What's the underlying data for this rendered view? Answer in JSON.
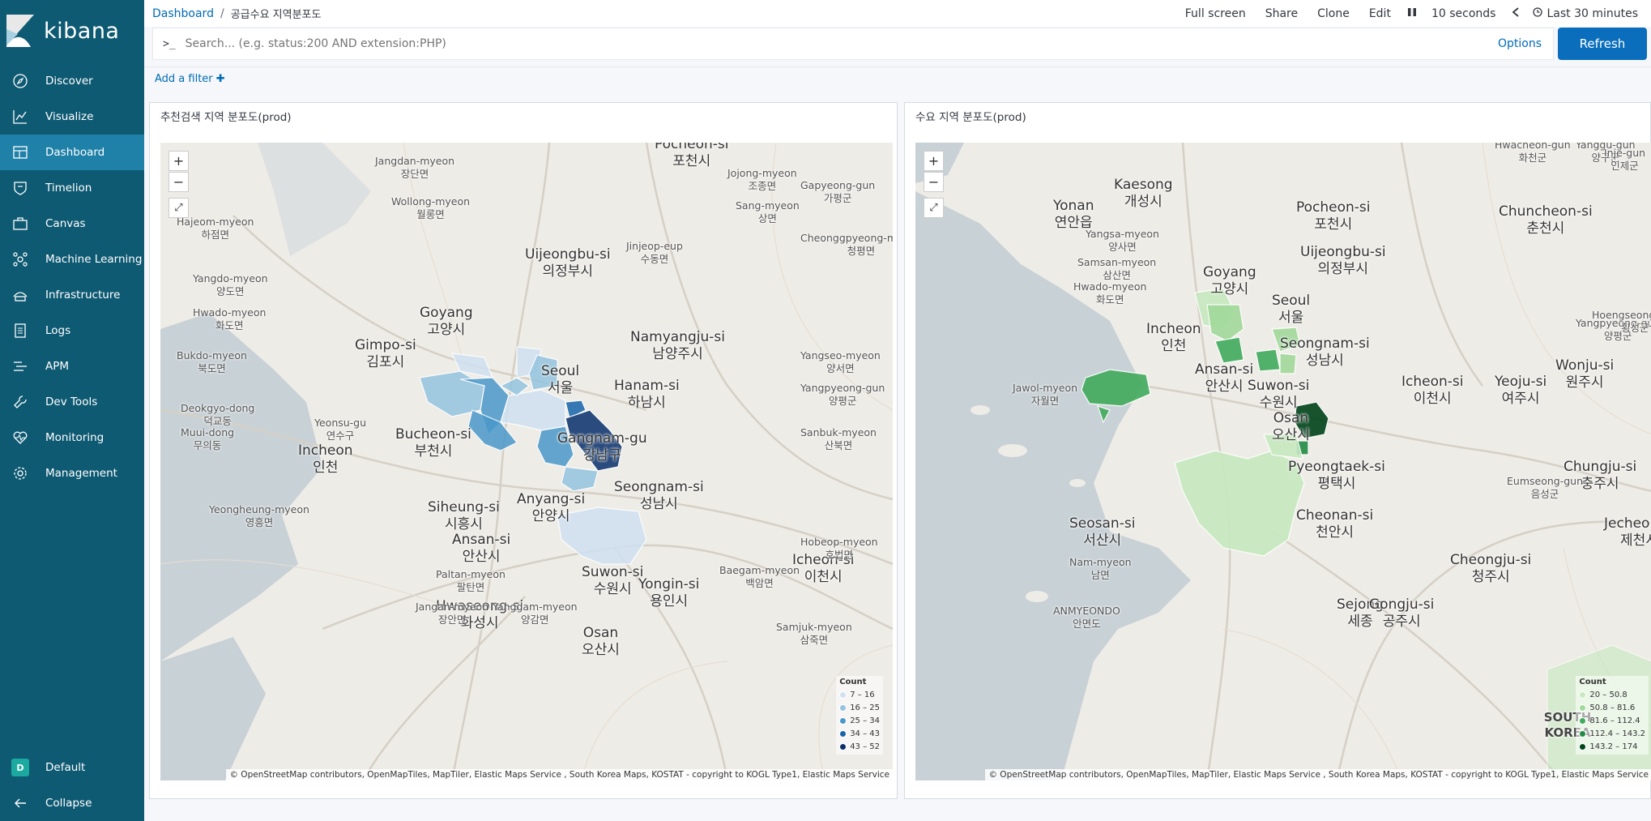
{
  "app": {
    "logo_text": "kibana"
  },
  "sidebar": {
    "items": [
      {
        "label": "Discover",
        "icon": "compass-icon"
      },
      {
        "label": "Visualize",
        "icon": "chart-icon"
      },
      {
        "label": "Dashboard",
        "icon": "dashboard-icon"
      },
      {
        "label": "Timelion",
        "icon": "shield-icon"
      },
      {
        "label": "Canvas",
        "icon": "briefcase-icon"
      },
      {
        "label": "Machine Learning",
        "icon": "ml-icon"
      },
      {
        "label": "Infrastructure",
        "icon": "infrastructure-icon"
      },
      {
        "label": "Logs",
        "icon": "logs-icon"
      },
      {
        "label": "APM",
        "icon": "apm-icon"
      },
      {
        "label": "Dev Tools",
        "icon": "wrench-icon"
      },
      {
        "label": "Monitoring",
        "icon": "heartbeat-icon"
      },
      {
        "label": "Management",
        "icon": "gear-icon"
      }
    ],
    "space": {
      "label": "Default",
      "avatar": "D"
    },
    "collapse_label": "Collapse"
  },
  "breadcrumb": {
    "root": "Dashboard",
    "separator": "/",
    "current": "공급수요 지역분포도"
  },
  "top_actions": {
    "full_screen": "Full screen",
    "share": "Share",
    "clone": "Clone",
    "edit": "Edit",
    "interval": "10 seconds",
    "time_range": "Last 30 minutes"
  },
  "query": {
    "prompt": ">_",
    "placeholder": "Search... (e.g. status:200 AND extension:PHP)",
    "options_label": "Options",
    "refresh_label": "Refresh"
  },
  "filter": {
    "add_label": "Add a filter"
  },
  "panels": [
    {
      "title": "추천검색 지역 분포도(prod)",
      "legend": {
        "title": "Count",
        "items": [
          {
            "label": "7 – 16",
            "color": "#d0e1f2"
          },
          {
            "label": "16 – 25",
            "color": "#94c4df"
          },
          {
            "label": "25 – 34",
            "color": "#4a98c9"
          },
          {
            "label": "34 – 43",
            "color": "#1764ab"
          },
          {
            "label": "43 – 52",
            "color": "#08306b"
          }
        ]
      },
      "labels": [
        [
          "Pocheon-si",
          "포천시"
        ],
        [
          "Uijeongbu-si",
          "의정부시"
        ],
        [
          "Goyang",
          "고양시"
        ],
        [
          "Namyangju-si",
          "남양주시"
        ],
        [
          "Gimpo-si",
          "김포시"
        ],
        [
          "Seoul",
          "서울"
        ],
        [
          "Hanam-si",
          "하남시"
        ],
        [
          "Bucheon-si",
          "부천시"
        ],
        [
          "Incheon",
          "인천"
        ],
        [
          "Gangnam-gu",
          "강남구"
        ],
        [
          "Seongnam-si",
          "성남시"
        ],
        [
          "Siheung-si",
          "시흥시"
        ],
        [
          "Anyang-si",
          "안양시"
        ],
        [
          "Ansan-si",
          "안산시"
        ],
        [
          "Suwon-si",
          "수원시"
        ],
        [
          "Yongin-si",
          "용인시"
        ],
        [
          "Icheon-si",
          "이천시"
        ],
        [
          "Hwaseong-si",
          "화성시"
        ],
        [
          "Osan",
          "오산시"
        ]
      ],
      "small_labels": [
        [
          "Jangdan-myeon",
          "장단면"
        ],
        [
          "Wollong-myeon",
          "월롱면"
        ],
        [
          "Hajeom-myeon",
          "하점면"
        ],
        [
          "Jojong-myeon",
          "조종면"
        ],
        [
          "Gapyeong-gun",
          "가평군"
        ],
        [
          "Sang-myeon",
          "상면"
        ],
        [
          "Cheonggpyeong-myeon",
          "청평면"
        ],
        [
          "Jinjeop-eup",
          "수동면"
        ],
        [
          "Yangdo-myeon",
          "양도면"
        ],
        [
          "Hwado-myeon",
          "화도면"
        ],
        [
          "Bukdo-myeon",
          "북도면"
        ],
        [
          "Yangseo-myeon",
          "양서면"
        ],
        [
          "Yangpyeong-gun",
          "양평군"
        ],
        [
          "Deokgyo-dong",
          "덕교동"
        ],
        [
          "Muui-dong",
          "무의동"
        ],
        [
          "Yeonsu-gu",
          "연수구"
        ],
        [
          "Sanbuk-myeon",
          "산북면"
        ],
        [
          "Yeongheung-myeon",
          "영흥면"
        ],
        [
          "Hobeop-myeon",
          "호법면"
        ],
        [
          "Paltan-myeon",
          "팔탄면"
        ],
        [
          "Baegam-myeon",
          "백암면"
        ],
        [
          "Jangan-myeon",
          "장안면"
        ],
        [
          "Yanggam-myeon",
          "양감면"
        ],
        [
          "Samjuk-myeon",
          "삼죽면"
        ]
      ],
      "attribution": "© OpenStreetMap contributors, OpenMapTiles, MapTiler, Elastic Maps Service , South Korea Maps, KOSTAT - copyright to KOGL Type1, Elastic Maps Service"
    },
    {
      "title": "수요 지역 분포도(prod)",
      "legend": {
        "title": "Count",
        "items": [
          {
            "label": "20 – 50.8",
            "color": "#c7e9c0"
          },
          {
            "label": "50.8 – 81.6",
            "color": "#a1d99b"
          },
          {
            "label": "81.6 – 112.4",
            "color": "#41ab5d"
          },
          {
            "label": "112.4 – 143.2",
            "color": "#238b45"
          },
          {
            "label": "143.2 – 174",
            "color": "#00441b"
          }
        ]
      },
      "labels": [
        [
          "Kaesong",
          "개성시"
        ],
        [
          "Pocheon-si",
          "포천시"
        ],
        [
          "Chuncheon-si",
          "춘천시"
        ],
        [
          "Yonan",
          "연안읍"
        ],
        [
          "Uijeongbu-si",
          "의정부시"
        ],
        [
          "Goyang",
          "고양시"
        ],
        [
          "Seoul",
          "서울"
        ],
        [
          "Incheon",
          "인천"
        ],
        [
          "Seongnam-si",
          "성남시"
        ],
        [
          "Ansan-si",
          "안산시"
        ],
        [
          "Suwon-si",
          "수원시"
        ],
        [
          "Icheon-si",
          "이천시"
        ],
        [
          "Yeoju-si",
          "여주시"
        ],
        [
          "Wonju-si",
          "원주시"
        ],
        [
          "Osan",
          "오산시"
        ],
        [
          "Pyeongtaek-si",
          "평택시"
        ],
        [
          "Chungju-si",
          "충주시"
        ],
        [
          "Seosan-si",
          "서산시"
        ],
        [
          "Cheonan-si",
          "천안시"
        ],
        [
          "Cheongju-si",
          "청주시"
        ],
        [
          "Sejong",
          "세종"
        ],
        [
          "Gongju-si",
          "공주시"
        ],
        [
          "Jecheon-si",
          "제천시"
        ]
      ],
      "small_labels": [
        [
          "Hwacheon-gun",
          "화천군"
        ],
        [
          "Yanggu-gun",
          "양구군"
        ],
        [
          "Inje-gun",
          "인제군"
        ],
        [
          "Yangsa-myeon",
          "양사면"
        ],
        [
          "Samsan-myeon",
          "삼산면"
        ],
        [
          "Hwado-myeon",
          "화도면"
        ],
        [
          "Yangpyeong-gun",
          "양평군"
        ],
        [
          "Hoengseong-gun",
          "횡성군"
        ],
        [
          "Jawol-myeon",
          "자월면"
        ],
        [
          "Eumseong-gun",
          "음성군"
        ],
        [
          "Nam-myeon",
          "남면"
        ],
        [
          "ANMYEONDO",
          "안면도"
        ]
      ],
      "attribution": "© OpenStreetMap contributors, OpenMapTiles, MapTiler, Elastic Maps Service , South Korea Maps, KOSTAT - copyright to KOGL Type1, Elastic Maps Service"
    }
  ],
  "map_controls": {
    "zoom_in": "+",
    "zoom_out": "−",
    "fit": "⤢"
  },
  "overlay_text": {
    "south_korea": "SOUTH KOREA"
  },
  "colors": {
    "sidebar": "#0f5a73",
    "active_nav": "#1f80a8",
    "link": "#006bb4",
    "primary": "#0a6ebd"
  }
}
